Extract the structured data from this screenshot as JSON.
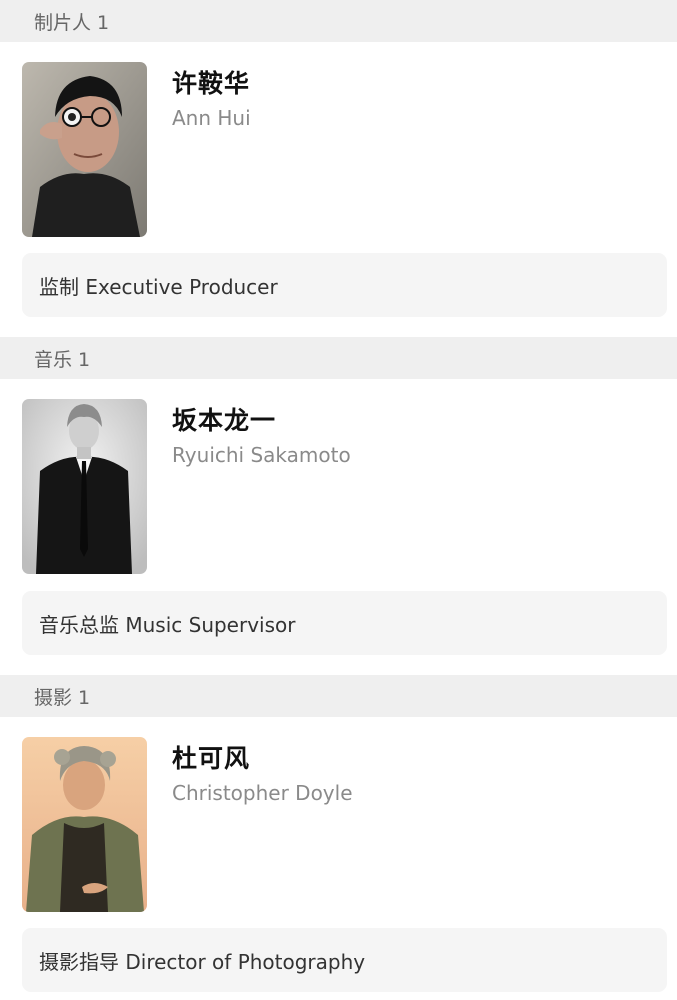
{
  "sections": [
    {
      "header": "制片人 1",
      "person": {
        "name_cn": "许鞍华",
        "name_en": "Ann Hui",
        "photo": "ann-hui-photo"
      },
      "role": "监制 Executive Producer"
    },
    {
      "header": "音乐 1",
      "person": {
        "name_cn": "坂本龙一",
        "name_en": "Ryuichi Sakamoto",
        "photo": "ryuichi-sakamoto-photo"
      },
      "role": "音乐总监 Music Supervisor"
    },
    {
      "header": "摄影 1",
      "person": {
        "name_cn": "杜可风",
        "name_en": "Christopher Doyle",
        "photo": "christopher-doyle-photo"
      },
      "role": "摄影指导 Director of Photography"
    }
  ],
  "colors": {
    "section_header_bg": "#efefef",
    "role_box_bg": "#f5f5f5",
    "secondary_text": "#8a8a8a"
  }
}
